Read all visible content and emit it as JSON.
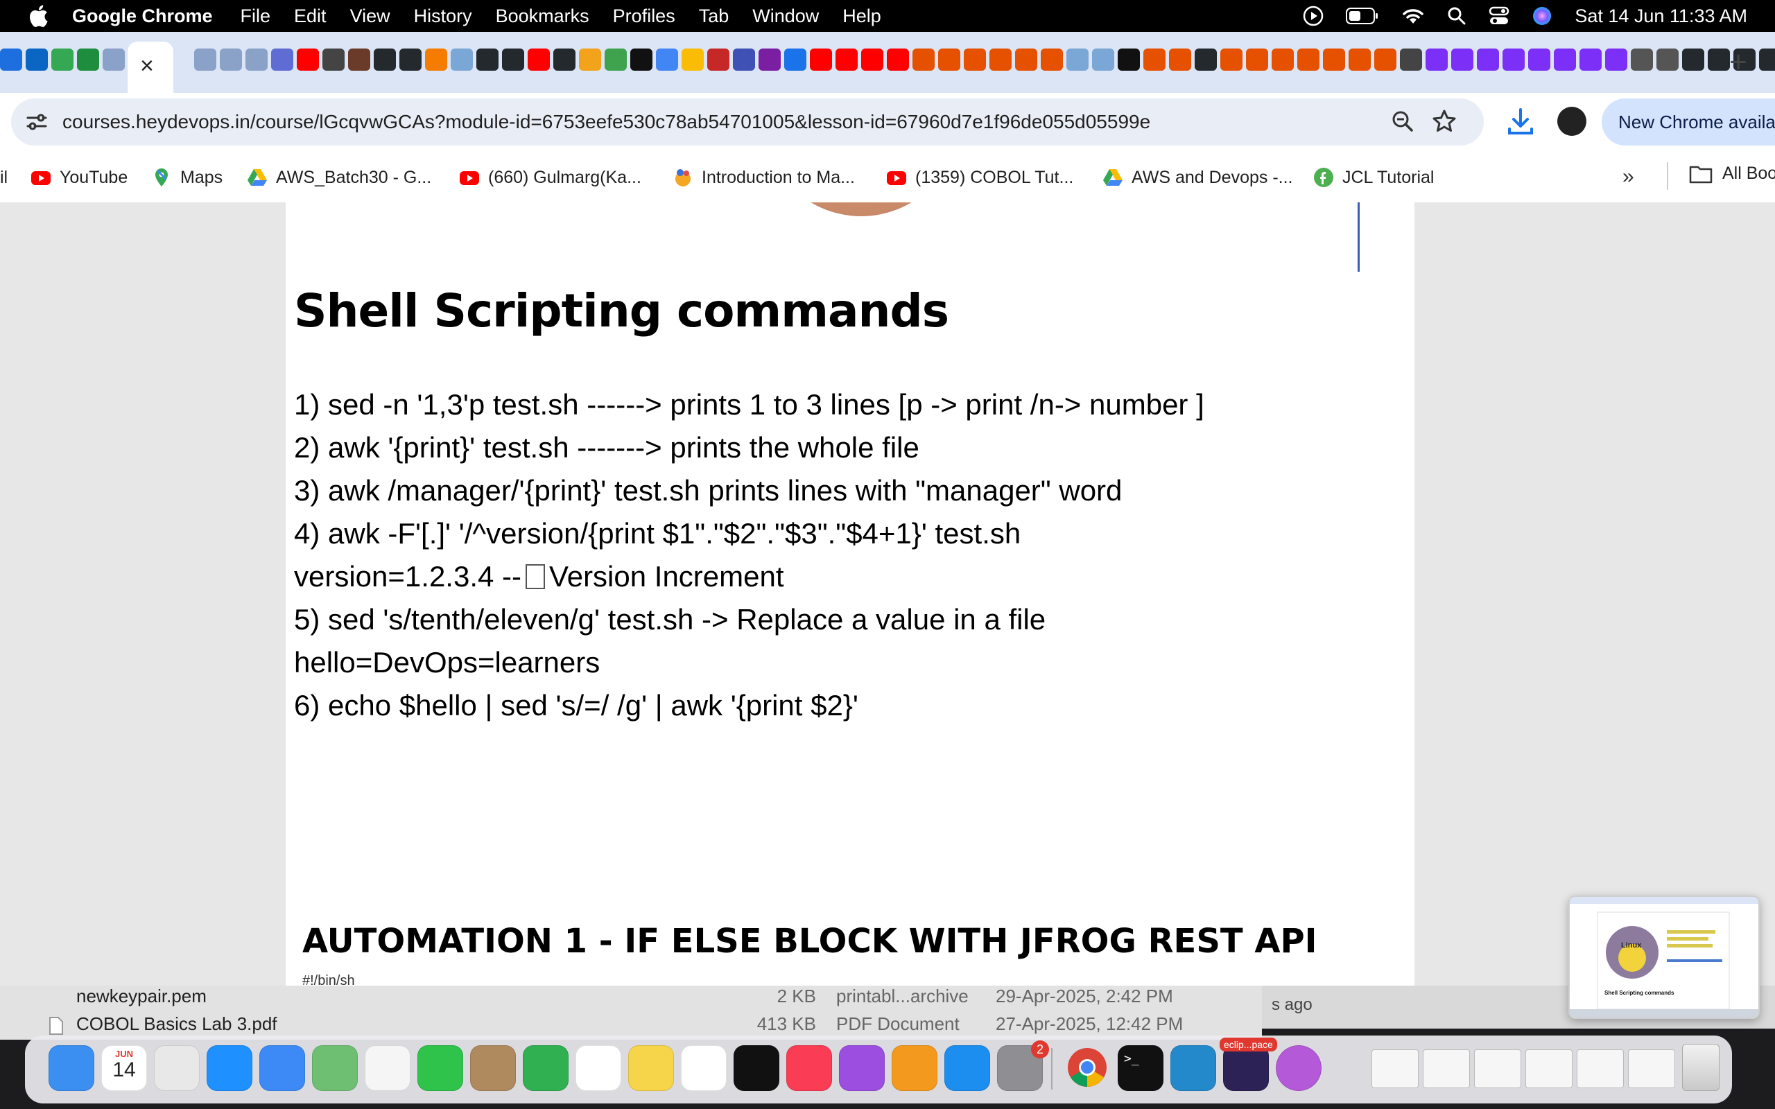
{
  "menubar": {
    "app_name": "Google Chrome",
    "menus": [
      "File",
      "Edit",
      "View",
      "History",
      "Bookmarks",
      "Profiles",
      "Tab",
      "Window",
      "Help"
    ],
    "clock": "Sat 14 Jun  11:33 AM"
  },
  "tabs": {
    "close_label": "×",
    "new_tab_label": "+",
    "favicon_colors": [
      "#1d6fe0",
      "#0a66c2",
      "#34a853",
      "#1e8e3e",
      "#8aa2c8",
      "#8aa2c8",
      "#8aa2c8",
      "#8aa2c8",
      "#5f6cd4",
      "#ff0000",
      "#444",
      "#6b3b2a",
      "#24292e",
      "#24292e",
      "#f57c00",
      "#7aa7d6",
      "#24292e",
      "#24292e",
      "#ff0000",
      "#24292e",
      "#f2a31b",
      "#3fa34d",
      "#111",
      "#4285f4",
      "#fbbc05",
      "#c62828",
      "#3f51b5",
      "#7b1fa2",
      "#1a73e8",
      "#ff0000",
      "#ff0000",
      "#ff0000",
      "#ff0000",
      "#e65100",
      "#e65100",
      "#e65100",
      "#e65100",
      "#e65100",
      "#e65100",
      "#7aa7d6",
      "#7aa7d6",
      "#111",
      "#e65100",
      "#e65100",
      "#24292e",
      "#e65100",
      "#e65100",
      "#e65100",
      "#e65100",
      "#e65100",
      "#e65100",
      "#e65100",
      "#444",
      "#7b2ff7",
      "#7b2ff7",
      "#7b2ff7",
      "#7b2ff7",
      "#7b2ff7",
      "#7b2ff7",
      "#7b2ff7",
      "#7b2ff7",
      "#555",
      "#555",
      "#24292e",
      "#24292e",
      "#24292e",
      "#24292e",
      "#4285f4",
      "#34a853",
      "#111",
      "#2196f3",
      "#ff0000",
      "#ff0000",
      "#f44336",
      "#e91e63",
      "#7b2ff7"
    ]
  },
  "toolbar": {
    "url": "courses.heydevops.in/course/lGcqvwGCAs?module-id=6753eefe530c78ab54701005&lesson-id=67960d7e1f96de055d05599e",
    "update_chip": "New Chrome available"
  },
  "bookmarks": {
    "items": [
      {
        "label": "il",
        "icon": "partial-icon",
        "color": "#888"
      },
      {
        "label": "YouTube",
        "icon": "youtube-icon",
        "color": "#ff0000"
      },
      {
        "label": "Maps",
        "icon": "maps-icon",
        "color": "#34a853"
      },
      {
        "label": "AWS_Batch30 - G...",
        "icon": "drive-icon",
        "color": "#fbbc05"
      },
      {
        "label": "(660) Gulmarg(Ka...",
        "icon": "youtube-icon",
        "color": "#ff0000"
      },
      {
        "label": "Introduction to Ma...",
        "icon": "course-icon",
        "color": "#f5a623"
      },
      {
        "label": "(1359) COBOL Tut...",
        "icon": "youtube-icon",
        "color": "#ff0000"
      },
      {
        "label": "AWS and Devops -...",
        "icon": "drive-icon",
        "color": "#fbbc05"
      },
      {
        "label": "JCL Tutorial",
        "icon": "tutorial-icon",
        "color": "#4caf50"
      }
    ],
    "more_label": "»",
    "all_label": "All Boo"
  },
  "doc": {
    "title": "Shell Scripting commands",
    "lines": [
      "1) sed -n '1,3'p test.sh     ------> prints 1 to 3 lines [p -> print /n-> number ]",
      "2) awk '{print}' test.sh     -------> prints the whole file",
      "3) awk /manager/'{print}' test.sh  prints lines with \"manager\" word",
      "4) awk -F'[.]' '/^version/{print $1\".\"$2\".\"$3\".\"$4+1}' test.sh",
      "version=1.2.3.4 --",
      "Version Increment",
      "5) sed 's/tenth/eleven/g' test.sh -> Replace a value in a file",
      "hello=DevOps=learners",
      "6) echo $hello | sed 's/=/ /g' | awk '{print $2}'"
    ],
    "heading2": "AUTOMATION 1 - IF ELSE BLOCK WITH JFROG REST API",
    "shebang": "#!/bin/sh"
  },
  "downloads": {
    "rows": [
      {
        "name": "newkeypair.pem",
        "size": "2 KB",
        "type": "printabl...archive",
        "date": "29-Apr-2025, 2:42 PM"
      },
      {
        "name": "COBOL Basics Lab 3.pdf",
        "size": "413 KB",
        "type": "PDF Document",
        "date": "27-Apr-2025, 12:42 PM"
      }
    ],
    "ago": "s ago"
  },
  "thumb": {
    "title": "Shell Scripting commands",
    "linux": "Linux"
  },
  "dock": {
    "calendar_month": "JUN",
    "calendar_day": "14",
    "settings_badge": "2",
    "eclipse_label": "eclip...pace",
    "apps": [
      {
        "name": "finder",
        "color": "#3b8ff0"
      },
      {
        "name": "calendar",
        "color": "#ffffff"
      },
      {
        "name": "launchpad",
        "color": "#e8e8e8"
      },
      {
        "name": "safari",
        "color": "#1e90ff"
      },
      {
        "name": "mail",
        "color": "#3d8af7"
      },
      {
        "name": "maps",
        "color": "#6fbf73"
      },
      {
        "name": "photos",
        "color": "#f5f5f5"
      },
      {
        "name": "facetime",
        "color": "#2fc34c"
      },
      {
        "name": "contacts",
        "color": "#b08a5f"
      },
      {
        "name": "numbers",
        "color": "#31b052"
      },
      {
        "name": "reminders",
        "color": "#ffffff"
      },
      {
        "name": "notes",
        "color": "#f7d54a"
      },
      {
        "name": "freeform",
        "color": "#ffffff"
      },
      {
        "name": "apple-tv",
        "color": "#111111"
      },
      {
        "name": "music",
        "color": "#fa3c55"
      },
      {
        "name": "podcasts",
        "color": "#9b4ee0"
      },
      {
        "name": "pages",
        "color": "#f39a1e"
      },
      {
        "name": "app-store",
        "color": "#1c8ef0"
      },
      {
        "name": "system-settings",
        "color": "#8e8e93"
      },
      {
        "name": "chrome",
        "color": "#ffffff"
      },
      {
        "name": "terminal",
        "color": "#111111"
      },
      {
        "name": "vscode",
        "color": "#2489ca"
      },
      {
        "name": "eclipse",
        "color": "#2c2255"
      },
      {
        "name": "flower-app",
        "color": "#b45ad8"
      }
    ]
  }
}
